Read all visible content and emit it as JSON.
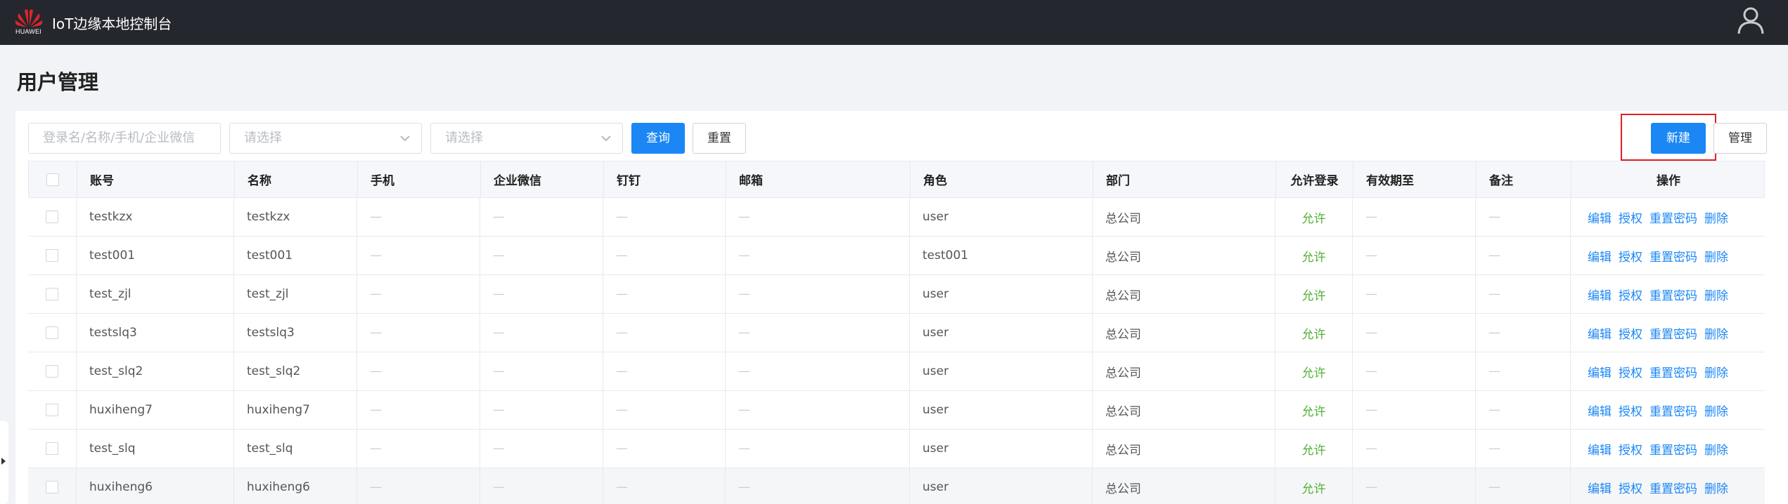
{
  "header": {
    "brand": "HUAWEI",
    "app_title": "IoT边缘本地控制台",
    "icons": {
      "logo": "huawei-logo-icon",
      "user": "user-icon"
    },
    "colors": {
      "bar": "#25272e",
      "logo_red": "#e0242b"
    }
  },
  "page": {
    "title": "用户管理"
  },
  "filters": {
    "search_placeholder": "登录名/名称/手机/企业微信",
    "select1_placeholder": "请选择",
    "select2_placeholder": "请选择",
    "query_label": "查询",
    "reset_label": "重置",
    "new_label": "新建",
    "manage_label": "管理"
  },
  "table": {
    "columns": [
      "账号",
      "名称",
      "手机",
      "企业微信",
      "钉钉",
      "邮箱",
      "角色",
      "部门",
      "允许登录",
      "有效期至",
      "备注",
      "操作"
    ],
    "actions": [
      "编辑",
      "授权",
      "重置密码",
      "删除"
    ],
    "rows": [
      {
        "account": "testkzx",
        "name": "testkzx",
        "phone": "—",
        "wecom": "—",
        "dingtalk": "—",
        "email": "—",
        "role": "user",
        "dept": "总公司",
        "allow": "允许",
        "expire": "—",
        "remark": "—"
      },
      {
        "account": "test001",
        "name": "test001",
        "phone": "—",
        "wecom": "—",
        "dingtalk": "—",
        "email": "—",
        "role": "test001",
        "dept": "总公司",
        "allow": "允许",
        "expire": "—",
        "remark": "—"
      },
      {
        "account": "test_zjl",
        "name": "test_zjl",
        "phone": "—",
        "wecom": "—",
        "dingtalk": "—",
        "email": "—",
        "role": "user",
        "dept": "总公司",
        "allow": "允许",
        "expire": "—",
        "remark": "—"
      },
      {
        "account": "testslq3",
        "name": "testslq3",
        "phone": "—",
        "wecom": "—",
        "dingtalk": "—",
        "email": "—",
        "role": "user",
        "dept": "总公司",
        "allow": "允许",
        "expire": "—",
        "remark": "—"
      },
      {
        "account": "test_slq2",
        "name": "test_slq2",
        "phone": "—",
        "wecom": "—",
        "dingtalk": "—",
        "email": "—",
        "role": "user",
        "dept": "总公司",
        "allow": "允许",
        "expire": "—",
        "remark": "—"
      },
      {
        "account": "huxiheng7",
        "name": "huxiheng7",
        "phone": "—",
        "wecom": "—",
        "dingtalk": "—",
        "email": "—",
        "role": "user",
        "dept": "总公司",
        "allow": "允许",
        "expire": "—",
        "remark": "—"
      },
      {
        "account": "test_slq",
        "name": "test_slq",
        "phone": "—",
        "wecom": "—",
        "dingtalk": "—",
        "email": "—",
        "role": "user",
        "dept": "总公司",
        "allow": "允许",
        "expire": "—",
        "remark": "—"
      },
      {
        "account": "huxiheng6",
        "name": "huxiheng6",
        "phone": "—",
        "wecom": "—",
        "dingtalk": "—",
        "email": "—",
        "role": "user",
        "dept": "总公司",
        "allow": "允许",
        "expire": "—",
        "remark": "—"
      }
    ]
  },
  "colors": {
    "primary": "#1b87f5",
    "allow_green": "#52b035",
    "highlight_red": "#e02020"
  }
}
